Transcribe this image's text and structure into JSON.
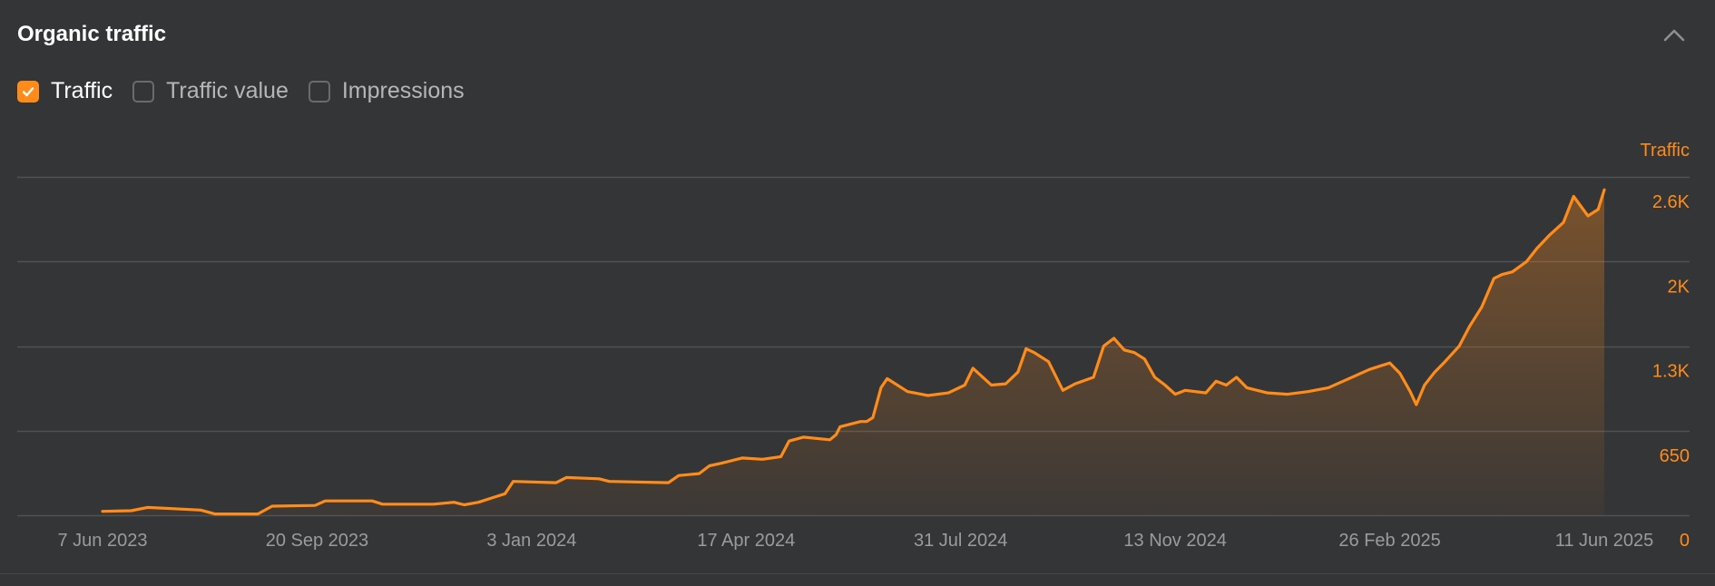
{
  "panel": {
    "title": "Organic traffic",
    "collapse_icon": "chevron-up-icon"
  },
  "legend": {
    "items": [
      {
        "label": "Traffic",
        "checked": true
      },
      {
        "label": "Traffic value",
        "checked": false
      },
      {
        "label": "Impressions",
        "checked": false
      }
    ]
  },
  "colors": {
    "accent": "#ff8c1a",
    "background": "#343537",
    "grid": "#505154",
    "muted_text": "#9a9b9e"
  },
  "chart_data": {
    "type": "area",
    "y_axis_title": "Traffic",
    "y_ticks": [
      "0",
      "650",
      "1.3K",
      "2K",
      "2.6K"
    ],
    "y_tick_values": [
      0,
      650,
      1300,
      1950,
      2600
    ],
    "ylim": [
      0,
      2600
    ],
    "x_ticks": [
      "7 Jun 2023",
      "20 Sep 2023",
      "3 Jan 2024",
      "17 Apr 2024",
      "31 Jul 2024",
      "13 Nov 2024",
      "26 Feb 2025",
      "11 Jun 2025"
    ],
    "x_tick_dates": [
      "2023-06-07",
      "2023-09-20",
      "2024-01-03",
      "2024-04-17",
      "2024-07-31",
      "2024-11-13",
      "2025-02-26",
      "2025-06-11"
    ],
    "xlim": [
      "2023-06-07",
      "2025-06-11"
    ],
    "grid": true,
    "series": [
      {
        "name": "Traffic",
        "points": [
          [
            "2023-06-07",
            30
          ],
          [
            "2023-06-21",
            35
          ],
          [
            "2023-06-29",
            60
          ],
          [
            "2023-07-12",
            50
          ],
          [
            "2023-07-25",
            40
          ],
          [
            "2023-08-01",
            10
          ],
          [
            "2023-08-22",
            10
          ],
          [
            "2023-08-29",
            70
          ],
          [
            "2023-09-19",
            75
          ],
          [
            "2023-09-24",
            110
          ],
          [
            "2023-10-17",
            110
          ],
          [
            "2023-10-22",
            85
          ],
          [
            "2023-11-16",
            85
          ],
          [
            "2023-11-26",
            100
          ],
          [
            "2023-12-01",
            80
          ],
          [
            "2023-12-08",
            100
          ],
          [
            "2023-12-16",
            140
          ],
          [
            "2023-12-21",
            165
          ],
          [
            "2023-12-25",
            260
          ],
          [
            "2024-01-15",
            250
          ],
          [
            "2024-01-20",
            290
          ],
          [
            "2024-02-05",
            280
          ],
          [
            "2024-02-10",
            260
          ],
          [
            "2024-03-10",
            250
          ],
          [
            "2024-03-15",
            305
          ],
          [
            "2024-03-25",
            320
          ],
          [
            "2024-03-30",
            380
          ],
          [
            "2024-04-05",
            400
          ],
          [
            "2024-04-15",
            440
          ],
          [
            "2024-04-25",
            430
          ],
          [
            "2024-05-04",
            450
          ],
          [
            "2024-05-08",
            570
          ],
          [
            "2024-05-15",
            600
          ],
          [
            "2024-05-28",
            580
          ],
          [
            "2024-05-31",
            620
          ],
          [
            "2024-06-02",
            680
          ],
          [
            "2024-06-12",
            720
          ],
          [
            "2024-06-15",
            720
          ],
          [
            "2024-06-18",
            750
          ],
          [
            "2024-06-22",
            980
          ],
          [
            "2024-06-25",
            1050
          ],
          [
            "2024-07-05",
            950
          ],
          [
            "2024-07-15",
            920
          ],
          [
            "2024-07-25",
            940
          ],
          [
            "2024-08-02",
            1000
          ],
          [
            "2024-08-06",
            1130
          ],
          [
            "2024-08-15",
            1000
          ],
          [
            "2024-08-22",
            1010
          ],
          [
            "2024-08-28",
            1100
          ],
          [
            "2024-09-01",
            1280
          ],
          [
            "2024-09-05",
            1250
          ],
          [
            "2024-09-12",
            1180
          ],
          [
            "2024-09-19",
            960
          ],
          [
            "2024-09-25",
            1010
          ],
          [
            "2024-10-04",
            1060
          ],
          [
            "2024-10-09",
            1300
          ],
          [
            "2024-10-14",
            1360
          ],
          [
            "2024-10-19",
            1270
          ],
          [
            "2024-10-24",
            1250
          ],
          [
            "2024-10-29",
            1200
          ],
          [
            "2024-11-03",
            1060
          ],
          [
            "2024-11-08",
            1000
          ],
          [
            "2024-11-13",
            930
          ],
          [
            "2024-11-18",
            960
          ],
          [
            "2024-11-28",
            940
          ],
          [
            "2024-12-03",
            1030
          ],
          [
            "2024-12-08",
            1000
          ],
          [
            "2024-12-13",
            1060
          ],
          [
            "2024-12-18",
            980
          ],
          [
            "2024-12-28",
            940
          ],
          [
            "2025-01-07",
            930
          ],
          [
            "2025-01-17",
            950
          ],
          [
            "2025-01-27",
            980
          ],
          [
            "2025-02-06",
            1050
          ],
          [
            "2025-02-16",
            1120
          ],
          [
            "2025-02-26",
            1170
          ],
          [
            "2025-03-03",
            1090
          ],
          [
            "2025-03-08",
            950
          ],
          [
            "2025-03-11",
            850
          ],
          [
            "2025-03-15",
            1000
          ],
          [
            "2025-03-20",
            1100
          ],
          [
            "2025-03-25",
            1180
          ],
          [
            "2025-04-01",
            1300
          ],
          [
            "2025-04-06",
            1450
          ],
          [
            "2025-04-12",
            1600
          ],
          [
            "2025-04-18",
            1820
          ],
          [
            "2025-04-22",
            1850
          ],
          [
            "2025-04-27",
            1870
          ],
          [
            "2025-05-04",
            1950
          ],
          [
            "2025-05-09",
            2050
          ],
          [
            "2025-05-15",
            2150
          ],
          [
            "2025-05-22",
            2250
          ],
          [
            "2025-05-27",
            2450
          ],
          [
            "2025-06-03",
            2300
          ],
          [
            "2025-06-08",
            2350
          ],
          [
            "2025-06-11",
            2500
          ]
        ]
      }
    ]
  }
}
